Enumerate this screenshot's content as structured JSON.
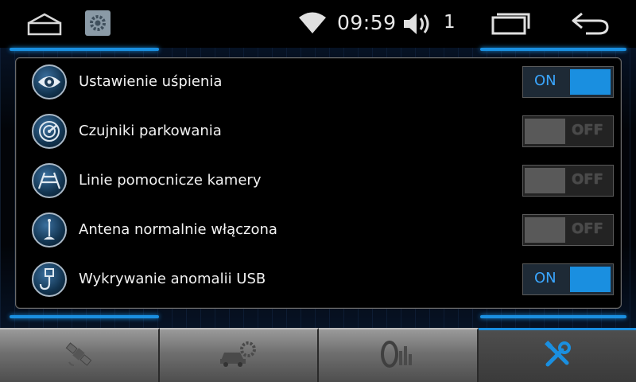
{
  "status_bar": {
    "time": "09:59",
    "volume_level": "1",
    "icons": [
      "home-icon",
      "settings-app-icon",
      "wifi-icon",
      "volume-icon",
      "recent-apps-icon",
      "back-icon"
    ]
  },
  "settings": [
    {
      "label": "Ustawienie uśpienia",
      "icon": "eye-icon",
      "state": "ON",
      "on": true
    },
    {
      "label": "Czujniki parkowania",
      "icon": "radar-icon",
      "state": "OFF",
      "on": false
    },
    {
      "label": "Linie pomocnicze kamery",
      "icon": "camera-lines-icon",
      "state": "OFF",
      "on": false
    },
    {
      "label": "Antena normalnie włączona",
      "icon": "antenna-icon",
      "state": "OFF",
      "on": false
    },
    {
      "label": "Wykrywanie anomalii USB",
      "icon": "usb-icon",
      "state": "ON",
      "on": true
    }
  ],
  "bottom_tabs": [
    {
      "icon": "satellite-icon",
      "active": false
    },
    {
      "icon": "car-settings-icon",
      "active": false
    },
    {
      "icon": "audio-settings-icon",
      "active": false
    },
    {
      "icon": "tools-icon",
      "active": true
    }
  ],
  "colors": {
    "accent": "#1a8fe0",
    "background": "#000000",
    "toggle_off": "#595959"
  }
}
